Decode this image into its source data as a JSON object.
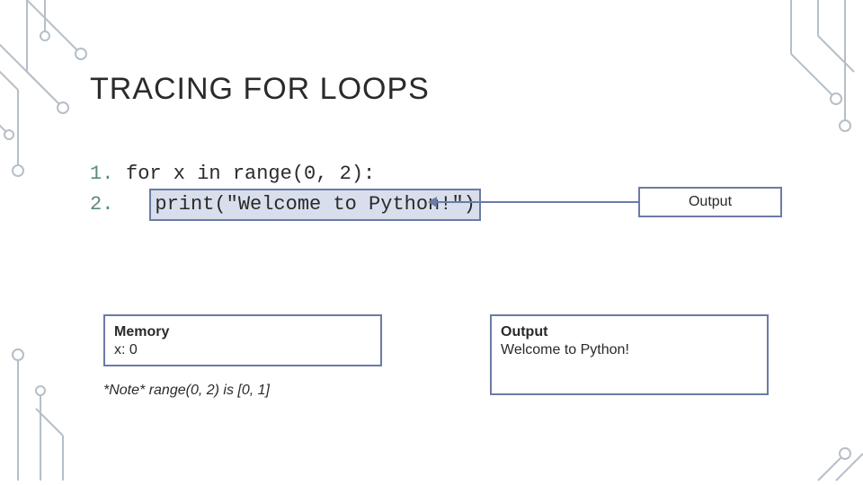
{
  "title": "TRACING FOR LOOPS",
  "code": {
    "line1_num": "1.",
    "line1_text": "for x in range(0, 2):",
    "line2_num": "2.",
    "line2_text": "print(\"Welcome to Python!\")"
  },
  "output_label": "Output",
  "memory": {
    "heading": "Memory",
    "content": "x: 0"
  },
  "output": {
    "heading": "Output",
    "content": "Welcome to Python!"
  },
  "note": "*Note* range(0, 2) is [0, 1]"
}
